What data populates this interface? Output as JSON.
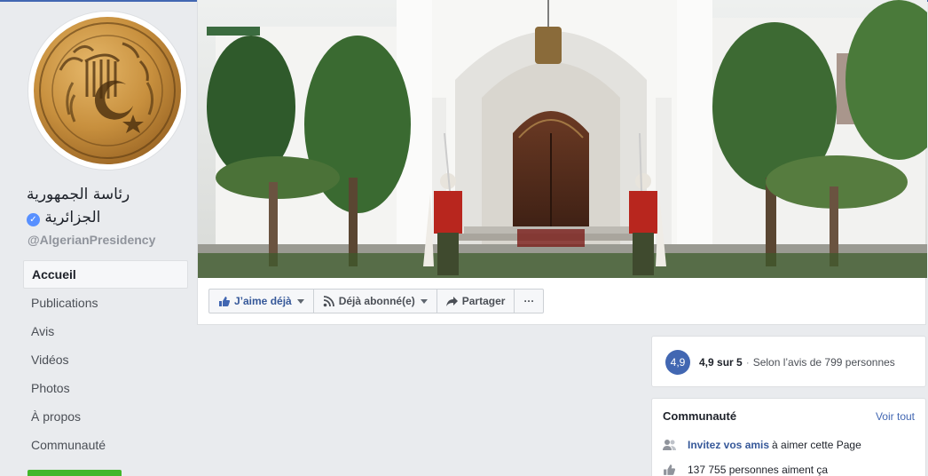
{
  "page": {
    "name_line1": "رئاسة الجمهورية",
    "name_line2": "الجزائرية",
    "handle": "@AlgerianPresidency",
    "verified_icon": "verified-badge-icon"
  },
  "nav": {
    "items": [
      {
        "label": "Accueil",
        "active": true
      },
      {
        "label": "Publications"
      },
      {
        "label": "Avis"
      },
      {
        "label": "Vidéos"
      },
      {
        "label": "Photos"
      },
      {
        "label": "À propos"
      },
      {
        "label": "Communauté"
      }
    ]
  },
  "actions": {
    "like_label": "J’aime déjà",
    "follow_label": "Déjà abonné(e)",
    "share_label": "Partager",
    "more_label": "···"
  },
  "rating": {
    "score": "4,9",
    "summary": "4,9 sur 5",
    "separator": "·",
    "sub": "Selon l’avis de 799 personnes"
  },
  "community": {
    "title": "Communauté",
    "see_all": "Voir tout",
    "invite_link": "Invitez vos amis",
    "invite_rest": "à aimer cette Page",
    "likes_text": "137 755 personnes aiment ça"
  },
  "colors": {
    "accent": "#4267b2",
    "link": "#365899",
    "background": "#e9ebee",
    "green": "#42b72a"
  }
}
